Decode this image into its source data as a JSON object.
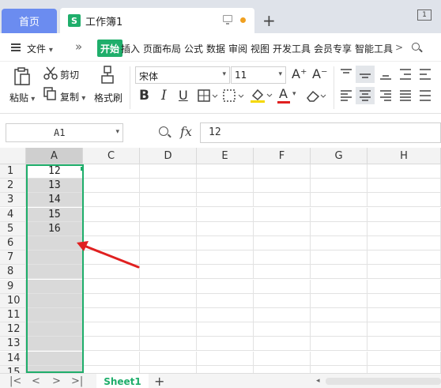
{
  "tabs": {
    "home": "首页",
    "doc_icon": "S",
    "doc_title": "工作簿1",
    "window_badge": "1"
  },
  "menu": {
    "file": "文件",
    "more": "»",
    "items": [
      "开始",
      "插入",
      "页面布局",
      "公式",
      "数据",
      "审阅",
      "视图",
      "开发工具",
      "会员专享",
      "智能工具"
    ],
    "next": ">"
  },
  "ribbon": {
    "paste": "粘贴",
    "cut": "剪切",
    "copy": "复制",
    "format_painter": "格式刷",
    "font_name": "宋体",
    "font_size": "11",
    "font_grow": "A⁺",
    "font_shrink": "A⁻",
    "bold": "B",
    "italic": "I",
    "underline": "U",
    "font_color": "A"
  },
  "formula": {
    "cell_ref": "A1",
    "fx": "fx",
    "value": "12"
  },
  "grid": {
    "columns": [
      "A",
      "C",
      "D",
      "E",
      "F",
      "G",
      "H"
    ],
    "rows": [
      "1",
      "2",
      "3",
      "4",
      "5",
      "6",
      "7",
      "8",
      "9",
      "10",
      "11",
      "12",
      "13",
      "14",
      "15"
    ],
    "colA_values": [
      "12",
      "13",
      "14",
      "15",
      "16"
    ]
  },
  "sheets": {
    "active": "Sheet1",
    "add": "+"
  },
  "colors": {
    "accent": "#1fae6b",
    "home_tab": "#6b8cf0",
    "arrow": "#e02020",
    "selection": "#d9d9d9"
  }
}
